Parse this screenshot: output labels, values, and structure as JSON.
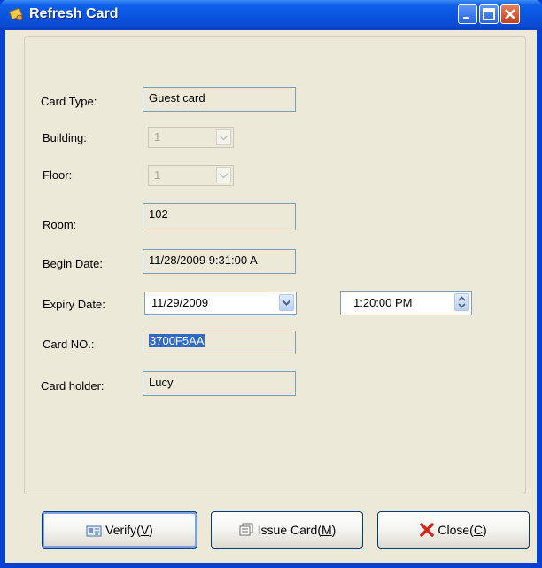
{
  "window": {
    "title": "Refresh Card",
    "icon": "card-key-icon",
    "controls": [
      "minimize-icon",
      "maximize-icon",
      "close-icon"
    ]
  },
  "form": {
    "card_type": {
      "label": "Card Type:",
      "value": "Guest card"
    },
    "building": {
      "label": "Building:",
      "value": "1"
    },
    "floor": {
      "label": "Floor:",
      "value": "1"
    },
    "room": {
      "label": "Room:",
      "value": "102"
    },
    "begin_date": {
      "label": "Begin Date:",
      "value": "11/28/2009 9:31:00 A"
    },
    "expiry_date": {
      "label": "Expiry Date:",
      "date": "11/29/2009",
      "time": "1:20:00 PM"
    },
    "card_no": {
      "label": "Card NO.:",
      "value": "3700F5AA"
    },
    "card_holder": {
      "label": "Card holder:",
      "value": "Lucy"
    }
  },
  "buttons": {
    "verify": {
      "text": "Verify(",
      "key": "V",
      "end": ")",
      "icon": "id-card-icon"
    },
    "issue": {
      "text": "Issue Card(",
      "key": "M",
      "end": ")",
      "icon": "copy-cards-icon"
    },
    "close": {
      "text": "Close(",
      "key": "C",
      "end": ")",
      "icon": "red-x-icon"
    }
  },
  "colors": {
    "titlebar": "#0a53dd",
    "window_bg": "#ece9d8",
    "selection": "#316ac5",
    "close_icon_red": "#d9261c"
  }
}
